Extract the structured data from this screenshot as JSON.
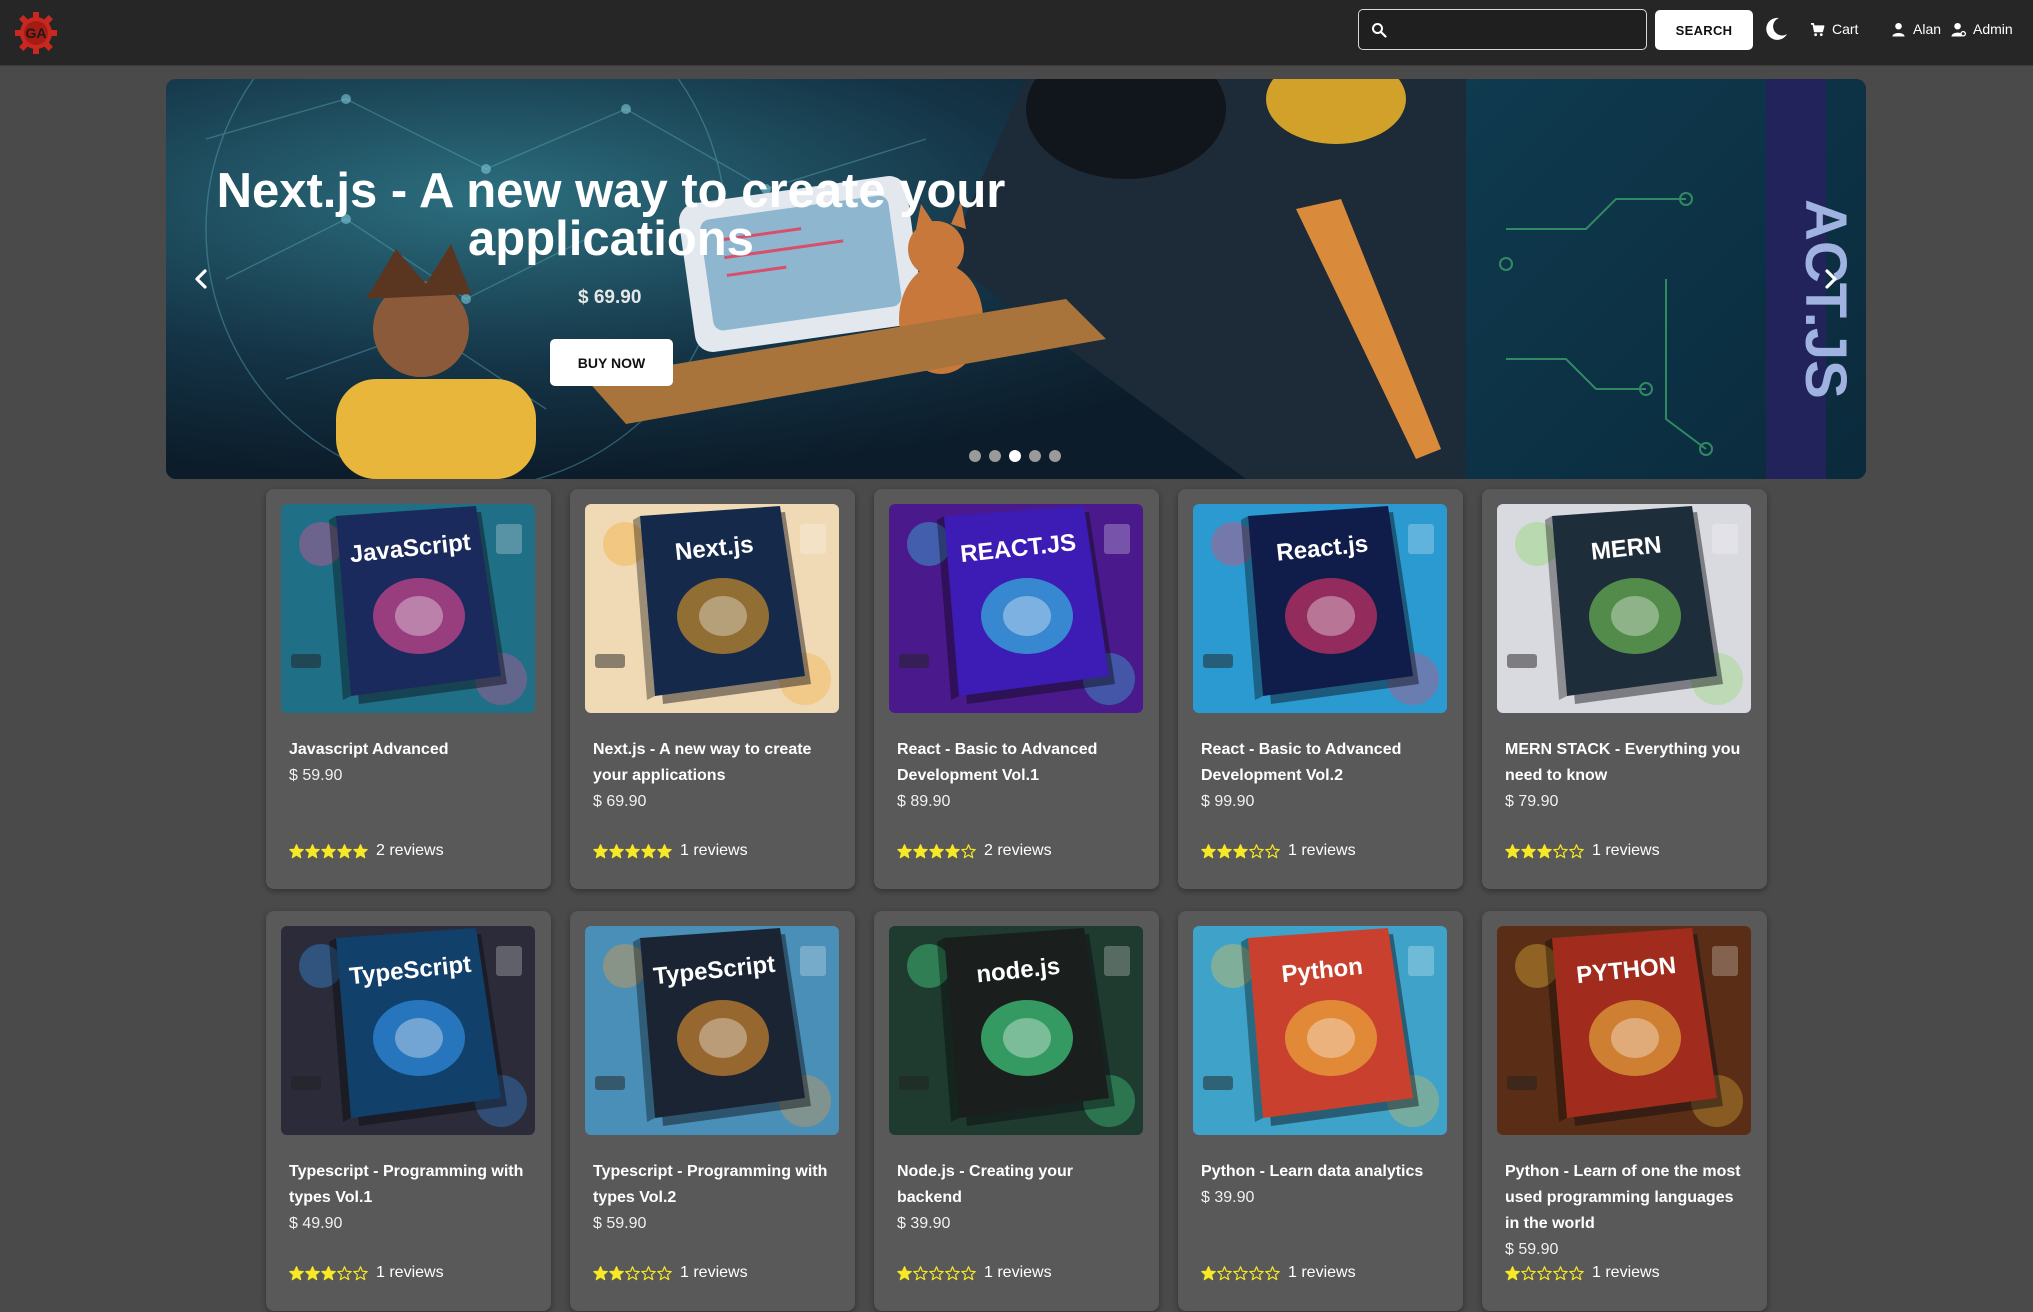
{
  "nav": {
    "logo_text": "GA",
    "search_placeholder": "",
    "search_label": "SEARCH",
    "cart_label": "Cart",
    "user_label": "Alan",
    "admin_label": "Admin"
  },
  "carousel": {
    "title": "Next.js - A new way to create your applications",
    "price": "$ 69.90",
    "button_label": "BUY NOW",
    "slide_count": 5,
    "active_slide": 3
  },
  "products": [
    {
      "name": "Javascript Advanced",
      "price": "$ 59.90",
      "rating": 5,
      "reviews": "2 reviews"
    },
    {
      "name": "Next.js - A new way to create your applications",
      "price": "$ 69.90",
      "rating": 5,
      "reviews": "1 reviews"
    },
    {
      "name": "React - Basic to Advanced Development Vol.1",
      "price": "$ 89.90",
      "rating": 4,
      "reviews": "2 reviews"
    },
    {
      "name": "React - Basic to Advanced Development Vol.2",
      "price": "$ 99.90",
      "rating": 3,
      "reviews": "1 reviews"
    },
    {
      "name": "MERN STACK - Everything you need to know",
      "price": "$ 79.90",
      "rating": 3,
      "reviews": "1 reviews"
    },
    {
      "name": "Typescript - Programming with types Vol.1",
      "price": "$ 49.90",
      "rating": 3,
      "reviews": "1 reviews"
    },
    {
      "name": "Typescript - Programming with types Vol.2",
      "price": "$ 59.90",
      "rating": 2,
      "reviews": "1 reviews"
    },
    {
      "name": "Node.js - Creating your backend",
      "price": "$ 39.90",
      "rating": 1,
      "reviews": "1 reviews"
    },
    {
      "name": "Python - Learn data analytics",
      "price": "$ 39.90",
      "rating": 1,
      "reviews": "1 reviews"
    },
    {
      "name": "Python - Learn of one the most used programming languages in the world",
      "price": "$ 59.90",
      "rating": 1,
      "reviews": "1 reviews"
    }
  ],
  "cover_art": [
    {
      "label": "JavaScript",
      "bg": "#1f6f86",
      "accent": "#ff4f9a",
      "book": "#1b2a5c"
    },
    {
      "label": "Next.js",
      "bg": "#f0d9b5",
      "accent": "#f5a623",
      "book": "#152a4a"
    },
    {
      "label": "REACT.JS",
      "bg": "#4a1a8c",
      "accent": "#34e0e8",
      "book": "#3d1bb5"
    },
    {
      "label": "React.js",
      "bg": "#2a9ad0",
      "accent": "#ff3b6b",
      "book": "#101c4a"
    },
    {
      "label": "MERN",
      "bg": "#d9d9e0",
      "accent": "#7ed957",
      "book": "#1d2d3a"
    },
    {
      "label": "TypeScript",
      "bg": "#2b2b3a",
      "accent": "#3aa0ff",
      "book": "#11406b"
    },
    {
      "label": "TypeScript",
      "bg": "#4a8fb8",
      "accent": "#ff9f2e",
      "book": "#1a2433"
    },
    {
      "label": "node.js",
      "bg": "#1f3a2f",
      "accent": "#4cff9a",
      "book": "#1a1f1d"
    },
    {
      "label": "Python",
      "bg": "#3fa3c9",
      "accent": "#f5c542",
      "book": "#c9412e"
    },
    {
      "label": "PYTHON",
      "bg": "#5a2e16",
      "accent": "#f5c542",
      "book": "#a12b1d"
    }
  ]
}
